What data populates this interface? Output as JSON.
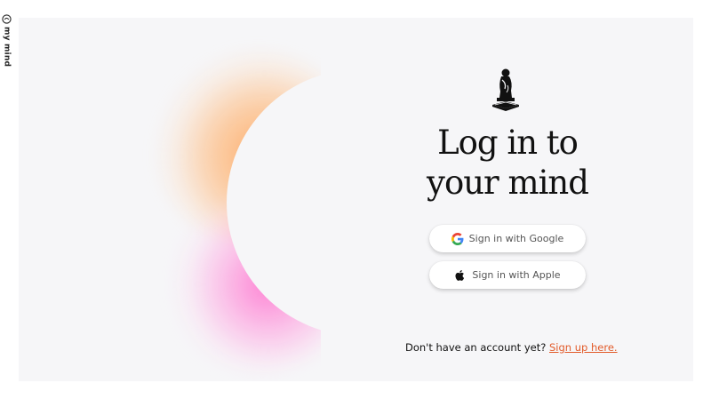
{
  "brand": {
    "label": "my mind",
    "icon": "mymind-logo-icon"
  },
  "login": {
    "logo_icon": "thinker-statue-icon",
    "title_line1": "Log in to",
    "title_line2": "your mind",
    "google_label": "Sign in with Google",
    "apple_label": "Sign in with Apple",
    "signup_prompt": "Don't have an account yet?",
    "signup_link": "Sign up here."
  },
  "colors": {
    "panel_bg": "#f6f6f8",
    "link": "#e25b2a",
    "glow_orange": "#ffa050",
    "glow_pink": "#ff6ecd"
  }
}
